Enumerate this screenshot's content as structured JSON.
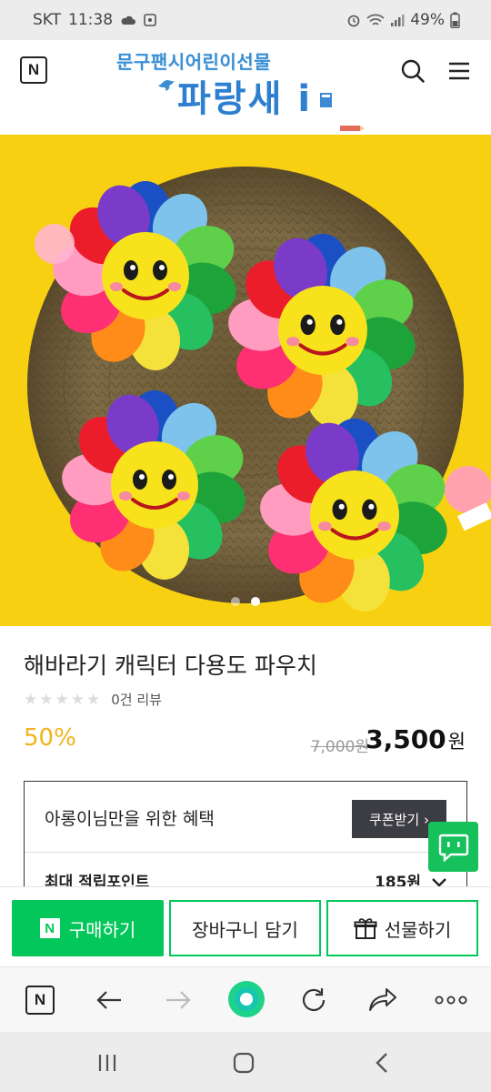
{
  "status_bar": {
    "carrier": "SKT",
    "time": "11:38",
    "battery": "49%",
    "icons": [
      "cloud-icon",
      "image-notification-icon",
      "alarm-icon",
      "wifi-icon",
      "signal-icon",
      "battery-icon"
    ]
  },
  "header": {
    "home_icon_label": "N",
    "store_logo_line1": "문구팬시어린이선물",
    "store_logo_line2": "파랑새 i",
    "icons": [
      "search-icon",
      "menu-icon"
    ]
  },
  "hero": {
    "slide_count": 2,
    "active_slide": 2
  },
  "product": {
    "title": "해바라기 캐릭터 다용도 파우치",
    "review_text": "0건 리뷰",
    "rating": 0,
    "discount": "50%",
    "original_price": "7,000원",
    "sale_price": "3,500",
    "sale_price_unit": "원"
  },
  "benefit": {
    "text": "아롱이님만을 위한 혜택",
    "coupon_label": "쿠폰받기 ›",
    "points_label": "최대 적립포인트",
    "points_value": "185원"
  },
  "purchase_bar": {
    "buy_label": "구매하기",
    "cart_label": "장바구니 담기",
    "gift_label": "선물하기"
  },
  "browser_bar": {
    "home_label": "N"
  },
  "colors": {
    "naver_green": "#03c75a",
    "hero_yellow": "#f8d012",
    "discount_gold": "#f0b41a"
  }
}
